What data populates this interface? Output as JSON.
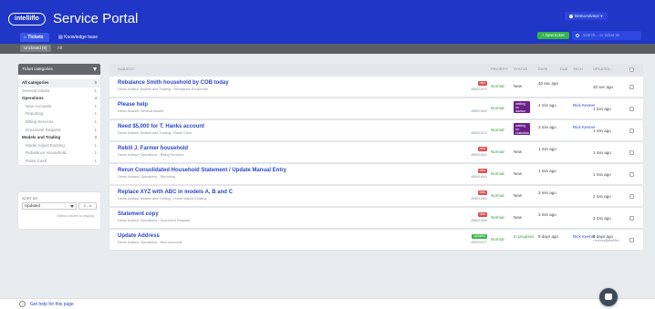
{
  "app": {
    "logo": "intelliflo",
    "title": "Service Portal",
    "user": "DemoAdvisor"
  },
  "nav": {
    "tickets": "Tickets",
    "knowledge_base": "Knowledge base"
  },
  "toolbar": {
    "new_ticket": "+ New ticket",
    "search_placeholder": "search... or ticket ID"
  },
  "subnav": {
    "unclosed": "Unclosed (8)",
    "all": "All"
  },
  "sidebar": {
    "header": "Ticket categories",
    "items": [
      {
        "label": "All categories",
        "count": "8",
        "type": "group"
      },
      {
        "label": "General Issues",
        "count": "1",
        "type": "item"
      },
      {
        "label": "Operations",
        "count": "4",
        "type": "group"
      },
      {
        "label": "New Accounts",
        "count": "1",
        "type": "sub"
      },
      {
        "label": "Reporting",
        "count": "1",
        "type": "sub"
      },
      {
        "label": "Billing Services",
        "count": "1",
        "type": "sub"
      },
      {
        "label": "Document Request",
        "count": "1",
        "type": "sub"
      },
      {
        "label": "Models and Trading",
        "count": "3",
        "type": "group"
      },
      {
        "label": "Model Adjust Existing",
        "count": "1",
        "type": "sub"
      },
      {
        "label": "Rebalance Household",
        "count": "1",
        "type": "sub"
      },
      {
        "label": "Raise Cash",
        "count": "1",
        "type": "sub"
      }
    ]
  },
  "sort": {
    "label": "SORT BY",
    "value": "Updated",
    "direction": "Z→A",
    "hint": "Select column to display..."
  },
  "table": {
    "headers": {
      "subject": "SUBJECT",
      "priority": "PRIORITY",
      "status": "STATUS",
      "date": "DATE",
      "due": "DUE",
      "tech": "TECH",
      "updated": "UPDATED ↓"
    },
    "rows": [
      {
        "subject": "Rebalance Smith household by COB today",
        "meta": "Demo Advisor  Models and Trading - Rebalance Household",
        "badge": "new",
        "badge_label": "new",
        "id": "#58001675",
        "priority": "Normal",
        "status": "New",
        "status_kind": "text",
        "date": "40 sec ago",
        "tech": "",
        "updated": "40 sec ago",
        "updated_sub": ""
      },
      {
        "subject": "Please help",
        "meta": "Demo Advisor  General Issues",
        "badge": "",
        "badge_label": "",
        "id": "#58001669",
        "priority": "Normal",
        "status": "waiting on advisor",
        "status_kind": "wait",
        "date": "4 min ago",
        "tech": "Rick Keener",
        "updated": "1 min ago",
        "updated_sub": ""
      },
      {
        "subject": "Need $5,000 for T. Hanks account",
        "meta": "Demo Advisor  Models and Trading - Raise Cash",
        "badge": "",
        "badge_label": "",
        "id": "#58001672",
        "priority": "Normal",
        "status": "waiting on custodian",
        "status_kind": "wait",
        "date": "3 min ago",
        "tech": "Rick Keener",
        "updated": "1 min ago",
        "updated_sub": ""
      },
      {
        "subject": "Rebill J. Farmer household",
        "meta": "Demo Advisor  Operations - Billing Services",
        "badge": "new",
        "badge_label": "new",
        "id": "#58001661",
        "priority": "Normal",
        "status": "New",
        "status_kind": "text",
        "date": "1 min ago",
        "tech": "",
        "updated": "1 min ago",
        "updated_sub": ""
      },
      {
        "subject": "Rerun Consolidated Household Statement / Update Manual Entry",
        "meta": "Demo Advisor  Operations - Reporting",
        "badge": "new",
        "badge_label": "new",
        "id": "#58001663",
        "priority": "Normal",
        "status": "New",
        "status_kind": "text",
        "date": "1 min ago",
        "tech": "",
        "updated": "1 min ago",
        "updated_sub": ""
      },
      {
        "subject": "Replace XYZ with ABC in models A, B and C",
        "meta": "Demo Advisor  Models and Trading - Model Adjust Existing",
        "badge": "new",
        "badge_label": "new",
        "id": "#58001665",
        "priority": "Normal",
        "status": "New",
        "status_kind": "text",
        "date": "2 min ago",
        "tech": "",
        "updated": "2 min ago",
        "updated_sub": ""
      },
      {
        "subject": "Statement copy",
        "meta": "Demo Advisor  Operations - Document Request",
        "badge": "new",
        "badge_label": "new",
        "id": "#58001666",
        "priority": "Normal",
        "status": "New",
        "status_kind": "text",
        "date": "3 min ago",
        "tech": "",
        "updated": "3 min ago",
        "updated_sub": ""
      },
      {
        "subject": "Update Address",
        "meta": "Demo Advisor  Operations - New Accounts",
        "badge": "upd",
        "badge_label": "updated",
        "id": "#58000477",
        "priority": "Normal",
        "status": "In progress",
        "status_kind": "prog",
        "date": "9 days ago",
        "tech": "Rick Keener",
        "updated": "6 days ago",
        "updated_sub": "r.keener@intellflo..."
      }
    ]
  },
  "footer": {
    "help": "Get help for this page"
  },
  "colors": {
    "header": "#1f36c7",
    "accent_green": "#35b34a",
    "link": "#2a48c8",
    "new_badge": "#d9534f",
    "waiting": "#6b1f8a"
  }
}
